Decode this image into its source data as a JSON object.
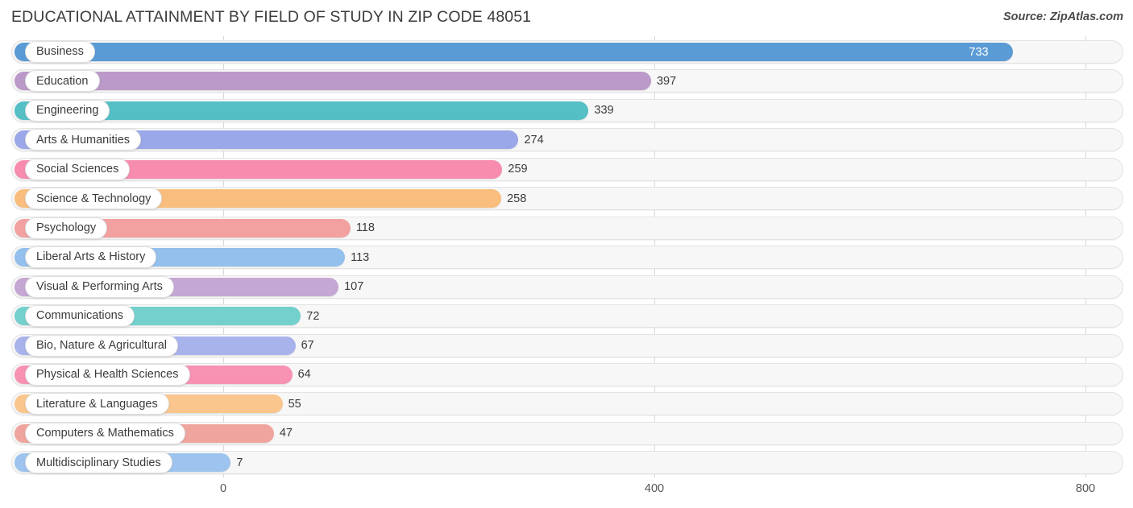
{
  "header": {
    "title": "EDUCATIONAL ATTAINMENT BY FIELD OF STUDY IN ZIP CODE 48051",
    "source": "Source: ZipAtlas.com"
  },
  "chart_data": {
    "type": "bar",
    "orientation": "horizontal",
    "title": "EDUCATIONAL ATTAINMENT BY FIELD OF STUDY IN ZIP CODE 48051",
    "xlabel": "",
    "ylabel": "",
    "xlim": [
      0,
      800
    ],
    "xticks": [
      0,
      400,
      800
    ],
    "xtick_labels": [
      "0",
      "400",
      "800"
    ],
    "grid": true,
    "legend": false,
    "categories": [
      "Business",
      "Education",
      "Engineering",
      "Arts & Humanities",
      "Social Sciences",
      "Science & Technology",
      "Psychology",
      "Liberal Arts & History",
      "Visual & Performing Arts",
      "Communications",
      "Bio, Nature & Agricultural",
      "Physical & Health Sciences",
      "Literature & Languages",
      "Computers & Mathematics",
      "Multidisciplinary Studies"
    ],
    "values": [
      733,
      397,
      339,
      274,
      259,
      258,
      118,
      113,
      107,
      72,
      67,
      64,
      55,
      47,
      7
    ],
    "value_labels": [
      "733",
      "397",
      "339",
      "274",
      "259",
      "258",
      "118",
      "113",
      "107",
      "72",
      "67",
      "64",
      "55",
      "47",
      "7"
    ],
    "colors": [
      "#5B9BD5",
      "#BB9AC9",
      "#55BFC6",
      "#9AA7E8",
      "#F78CAE",
      "#F9BE7E",
      "#F2A0A0",
      "#93C0ED",
      "#C4A7D3",
      "#73D0CC",
      "#A8B3EC",
      "#F792B2",
      "#FAC68D",
      "#EFA59E",
      "#9DC4EE"
    ]
  }
}
